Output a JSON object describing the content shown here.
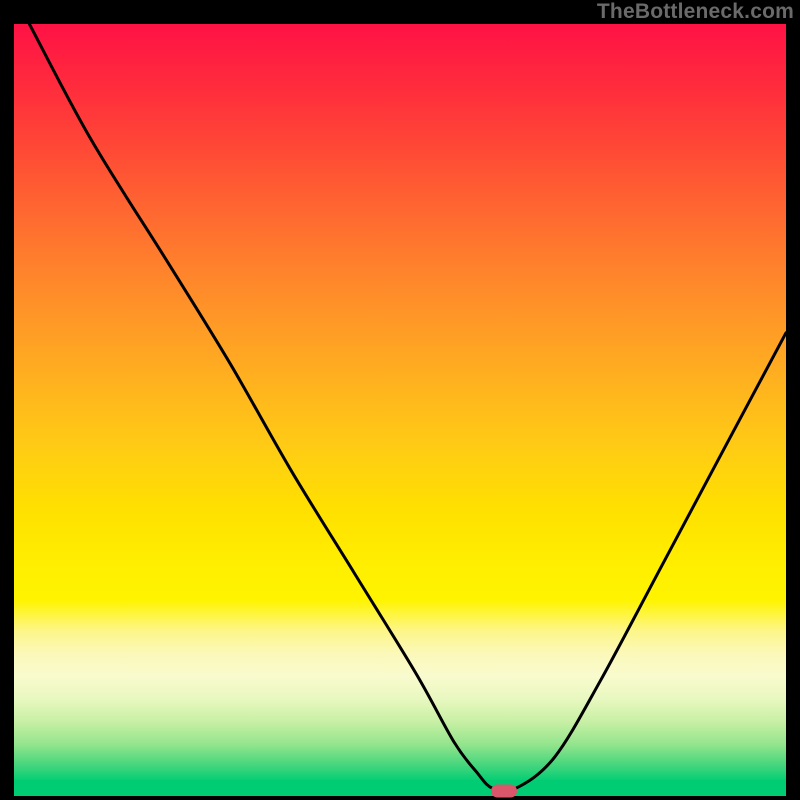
{
  "watermark": "TheBottleneck.com",
  "chart_data": {
    "type": "line",
    "title": "",
    "xlabel": "",
    "ylabel": "",
    "xlim": [
      0,
      100
    ],
    "ylim": [
      0,
      100
    ],
    "grid": false,
    "legend": false,
    "background": "rainbow_vertical_gradient",
    "series": [
      {
        "name": "bottleneck-curve",
        "x": [
          2,
          10,
          20,
          28,
          36,
          44,
          52,
          57,
          60,
          62,
          65,
          70,
          76,
          84,
          92,
          100
        ],
        "values": [
          100,
          85,
          69,
          56,
          42,
          29,
          16,
          7,
          3,
          1,
          1,
          5,
          15,
          30,
          45,
          60
        ]
      }
    ],
    "marker": {
      "x": 63.5,
      "y": 0.6,
      "color": "#d9566b"
    },
    "gradient_stops": [
      {
        "pos": 0,
        "color": "#ff1245"
      },
      {
        "pos": 0.5,
        "color": "#ffcc14"
      },
      {
        "pos": 0.78,
        "color": "#fff400"
      },
      {
        "pos": 0.87,
        "color": "#f9fbce"
      },
      {
        "pos": 1.0,
        "color": "#00cd74"
      }
    ]
  },
  "plot": {
    "inner_w": 772,
    "inner_h": 772,
    "curve_color": "#000000",
    "curve_width": 3
  }
}
